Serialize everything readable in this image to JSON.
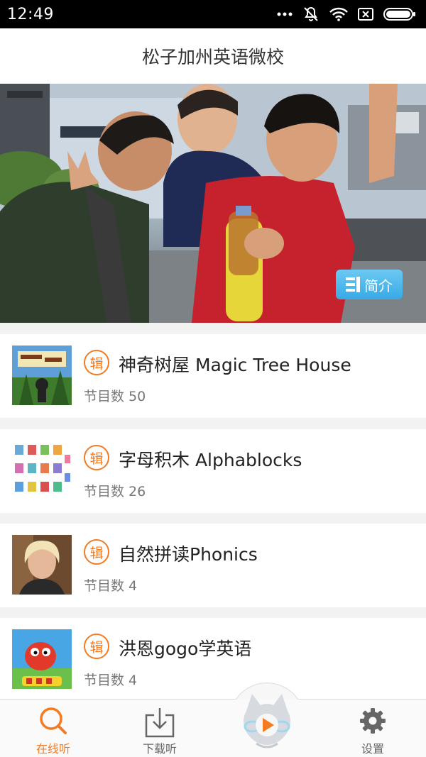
{
  "status_bar": {
    "time": "12:49",
    "icons": [
      "more-dots-icon",
      "mute-icon",
      "wifi-icon",
      "no-sim-icon",
      "battery-icon"
    ]
  },
  "app": {
    "title": "松子加州英语微校"
  },
  "hero": {
    "intro_button_label": "简介"
  },
  "albums": [
    {
      "badge": "辑",
      "title": "神奇树屋 Magic Tree House",
      "count": "节目数 50"
    },
    {
      "badge": "辑",
      "title": "字母积木 Alphablocks",
      "count": "节目数 26"
    },
    {
      "badge": "辑",
      "title": "自然拼读Phonics",
      "count": "节目数 4"
    },
    {
      "badge": "辑",
      "title": "洪恩gogo学英语",
      "count": "节目数 4"
    }
  ],
  "bottom_nav": {
    "items": [
      {
        "label": "在线听",
        "icon": "search-icon",
        "active": true
      },
      {
        "label": "下载听",
        "icon": "download-icon",
        "active": false
      },
      {
        "label": "设置",
        "icon": "gear-icon",
        "active": false
      }
    ],
    "player_icon": "play-icon"
  },
  "colors": {
    "accent": "#f47b22",
    "intro_button": "#3aa9e6",
    "status_bar": "#000000"
  }
}
